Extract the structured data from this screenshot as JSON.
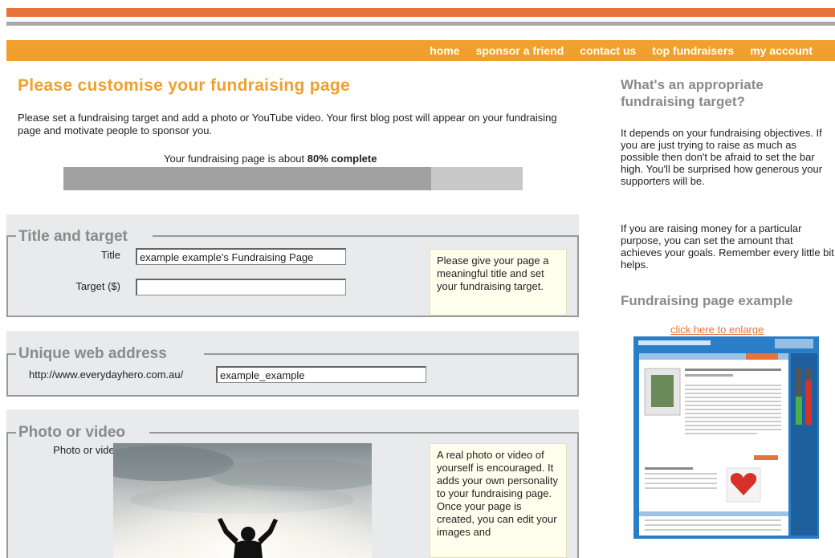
{
  "nav": {
    "items": [
      "home",
      "sponsor a friend",
      "contact us",
      "top fundraisers",
      "my account"
    ]
  },
  "page": {
    "title": "Please customise your fundraising page",
    "intro": "Please set a fundraising target and add a photo or YouTube video. Your first blog post will appear on your fundraising page and motivate people to sponsor you."
  },
  "progress": {
    "prefix": "Your fundraising page is about ",
    "value_text": "80% complete",
    "fraction": 0.8
  },
  "title_target": {
    "legend": "Title and target",
    "title_label": "Title",
    "title_value": "example example's Fundraising Page",
    "target_label": "Target ($)",
    "target_value": "",
    "tip": "Please give your page a meaningful title and set your fundraising target."
  },
  "web_address": {
    "legend": "Unique web address",
    "prefix": "http://www.everydayhero.com.au/",
    "value": "example_example"
  },
  "photo_video": {
    "legend": "Photo or video",
    "label": "Photo or video",
    "tip": "A real photo or video of yourself is encouraged. It adds your own personality to your fundraising page. Once your page is created, you can edit your images and"
  },
  "sidebar": {
    "heading1": "What's an appropriate fundraising target?",
    "para1": "It depends on your fundraising objectives. If you are just trying to raise as much as possible then don't be afraid to set the bar high. You'll be surprised how generous your supporters will be.",
    "para2": "If you are raising money for a particular purpose, you can set the amount that achieves your goals. Remember every little bit helps.",
    "heading2": "Fundraising page example",
    "enlarge": "click here to enlarge"
  },
  "colors": {
    "brand_orange": "#f0a02c",
    "accent_orange": "#e8733a",
    "legend_gray": "#8a8a8a"
  }
}
